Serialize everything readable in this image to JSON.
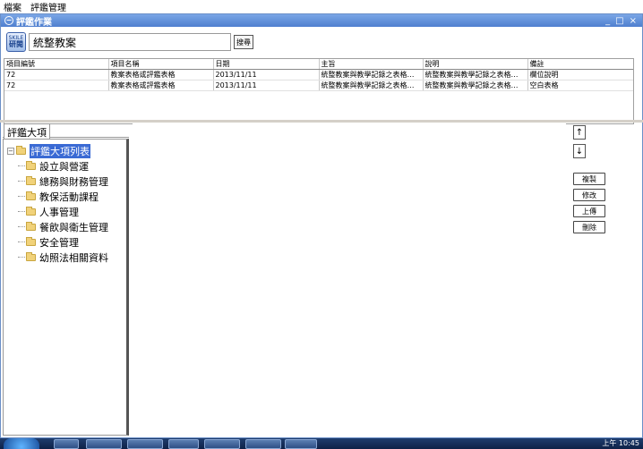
{
  "menu": {
    "items": [
      "檔案",
      "評鑑管理"
    ]
  },
  "window": {
    "title": "評鑑作業",
    "controls": [
      "_",
      "□",
      "×"
    ]
  },
  "toolbar": {
    "logo_top": "SKILE",
    "logo_bottom": "研閱",
    "title_value": "統整教案",
    "search_label": "搜尋"
  },
  "grid": {
    "columns": [
      "項目編號",
      "項目名稱",
      "日期",
      "主旨",
      "說明",
      "備註"
    ],
    "rows": [
      [
        "72",
        "教案表格或評鑑表格",
        "2013/11/11",
        "統整教案與教學記錄之表格…",
        "統整教案與教學記錄之表格…",
        "欄位說明"
      ],
      [
        "72",
        "教案表格或評鑑表格",
        "2013/11/11",
        "統整教案與教學記錄之表格…",
        "統整教案與教學記錄之表格…",
        "空白表格"
      ]
    ]
  },
  "left_panel": {
    "tab_label": "評鑑大項",
    "tree": {
      "root": "評鑑大項列表",
      "children": [
        "設立與營運",
        "總務與財務管理",
        "教保活動課程",
        "人事管理",
        "餐飲與衛生管理",
        "安全管理",
        "幼照法相關資料"
      ]
    }
  },
  "actions": {
    "up_label": "↑",
    "down_label": "↓",
    "copy_label": "複製",
    "edit_label": "修改",
    "upload_label": "上傳",
    "delete_label": "刪除"
  },
  "taskbar": {
    "clock": "上午 10:45"
  },
  "colors": {
    "titlebar": "#4f7fcf",
    "selection": "#3a6ad4",
    "folder": "#f1d27a",
    "taskbar": "#0e2147"
  }
}
